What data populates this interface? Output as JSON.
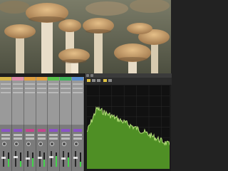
{
  "photo": {
    "subject": "mushroom-cluster-photo",
    "colors": {
      "background": "#6f725e",
      "cap": "#c89a66",
      "cap_dark": "#8b6a45",
      "stem": "#e8ddc8"
    }
  },
  "mixer": {
    "track_colors": [
      "#d7b64a",
      "#e08aa8",
      "#e0a040",
      "#e0a040",
      "#59c24a",
      "#3fb45a",
      "#5a8fcf"
    ],
    "send_colors": [
      "#8a52c8",
      "#8a52c8",
      "#c2468c",
      "#c2468c",
      "#8a52c8",
      "#8a52c8",
      "#8a52c8"
    ],
    "meter_levels": [
      0.55,
      0.4,
      0.6,
      0.5,
      0.75,
      0.65,
      0.35
    ],
    "fader_levels": [
      0.55,
      0.6,
      0.5,
      0.55,
      0.6,
      0.5,
      0.55
    ]
  },
  "analyzer": {
    "accent": "#e0c341",
    "fill_color": "#4f8f25",
    "line_color": "#b6e07a"
  }
}
